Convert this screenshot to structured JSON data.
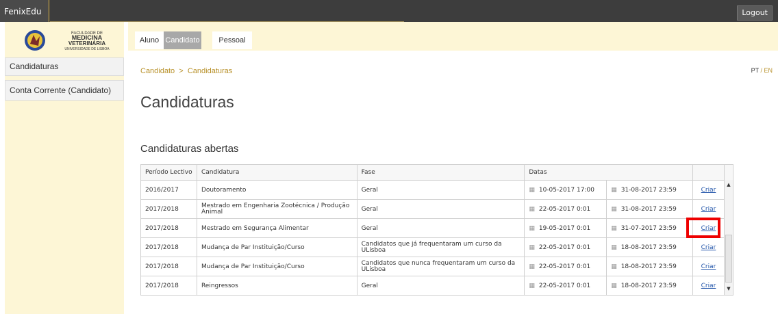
{
  "app": {
    "brand": "FenixEdu",
    "logout": "Logout"
  },
  "logo_lines": [
    "FACULDADE DE",
    "MEDICINA",
    "VETERINÁRIA",
    "UNIVERSIDADE DE LISBOA"
  ],
  "sidebar": {
    "items": [
      {
        "label": "Candidaturas"
      },
      {
        "label": "Conta Corrente (Candidato)"
      }
    ]
  },
  "tabs": [
    {
      "label": "Aluno"
    },
    {
      "label": "Candidato",
      "active": true
    },
    {
      "label": "Pessoal"
    }
  ],
  "breadcrumb": {
    "parent": "Candidato",
    "sep": ">",
    "current": "Candidaturas"
  },
  "lang": {
    "pt": "PT",
    "sep": "/",
    "en": "EN"
  },
  "page": {
    "title": "Candidaturas",
    "section": "Candidaturas abertas"
  },
  "table": {
    "headers": [
      "Período Lectivo",
      "Candidatura",
      "Fase",
      "Datas"
    ],
    "action_label": "Criar",
    "rows": [
      {
        "period": "2016/2017",
        "candidatura": "Doutoramento",
        "fase": "Geral",
        "start": "10-05-2017 17:00",
        "end": "31-08-2017 23:59"
      },
      {
        "period": "2017/2018",
        "candidatura": "Mestrado em Engenharia Zootécnica / Produção Animal",
        "fase": "Geral",
        "start": "22-05-2017 0:01",
        "end": "31-08-2017 23:59"
      },
      {
        "period": "2017/2018",
        "candidatura": "Mestrado em Segurança Alimentar",
        "fase": "Geral",
        "start": "19-05-2017 0:01",
        "end": "31-07-2017 23:59"
      },
      {
        "period": "2017/2018",
        "candidatura": "Mudança de Par Instituição/Curso",
        "fase": "Candidatos que já frequentaram um curso da ULisboa",
        "start": "22-05-2017 0:01",
        "end": "18-08-2017 23:59"
      },
      {
        "period": "2017/2018",
        "candidatura": "Mudança de Par Instituição/Curso",
        "fase": "Candidatos que nunca frequentaram um curso da ULisboa",
        "start": "22-05-2017 0:01",
        "end": "18-08-2017 23:59"
      },
      {
        "period": "2017/2018",
        "candidatura": "Reingressos",
        "fase": "Geral",
        "start": "22-05-2017 0:01",
        "end": "18-08-2017 23:59"
      }
    ]
  },
  "colors": {
    "accent": "#b8912a",
    "sidebar_bg": "#fdf6d6",
    "highlight": "#e00000"
  }
}
